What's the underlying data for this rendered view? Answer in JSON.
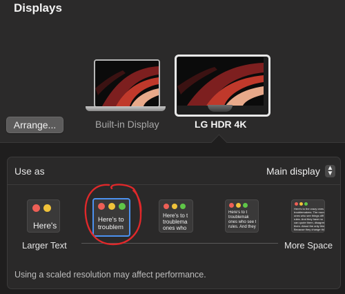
{
  "window": {
    "title": "Displays"
  },
  "arrange_button": "Arrange...",
  "displays": [
    {
      "label": "Built-in Display",
      "selected": false
    },
    {
      "label": "LG HDR 4K",
      "selected": true
    }
  ],
  "use_as": {
    "label": "Use as",
    "value": "Main display"
  },
  "resolution": {
    "left_label": "Larger Text",
    "right_label": "More Space",
    "options": [
      {
        "preview": "Here's"
      },
      {
        "preview": "Here's to\ntroublem",
        "selected": true
      },
      {
        "preview": "Here's to t\ntroublema\nones who"
      },
      {
        "preview": "Here's to t\ntroublemak\nones who see t\nrules. And they"
      },
      {
        "preview": "Here's to the crazy ones\ntroublemakers. The round\nones who see things diff\nrules. And they have no\ncan quote them, disagree\nthem. About the only thin\nBecause they change thin"
      }
    ]
  },
  "note": "Using a scaled resolution may affect performance.",
  "colors": {
    "accent": "#4c92f1",
    "annotation": "#e0282a"
  }
}
